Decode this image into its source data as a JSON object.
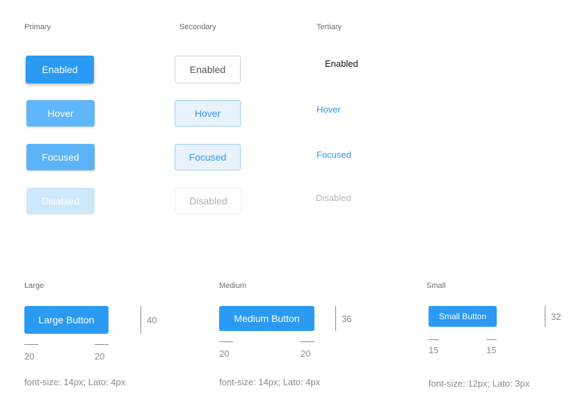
{
  "columns": {
    "primary": "Primary",
    "secondary": "Secondary",
    "tertiary": "Tertiary"
  },
  "states": {
    "primary": {
      "enabled": "Enabled",
      "hover": "Hover",
      "focused": "Focused",
      "disabled": "Disabled"
    },
    "secondary": {
      "enabled": "Enabled",
      "hover": "Hover",
      "focused": "Focused",
      "disabled": "Disabled"
    },
    "tertiary": {
      "enabled": "Enabled",
      "hover": "Hover",
      "focused": "Focused",
      "disabled": "Disabled"
    }
  },
  "sizes": {
    "large": {
      "heading": "Large",
      "button": "Large Button",
      "height": "40",
      "pad_left": "20",
      "pad_right": "20",
      "spec": "font-size: 14px; Lato: 4px"
    },
    "medium": {
      "heading": "Medium",
      "button": "Medium Button",
      "height": "36",
      "pad_left": "20",
      "pad_right": "20",
      "spec": "font-size: 14px; Lato: 4px"
    },
    "small": {
      "heading": "Small",
      "button": "Small Button",
      "height": "32",
      "pad_left": "15",
      "pad_right": "15",
      "spec": "font-size: 12px; Lato: 3px"
    }
  },
  "colors": {
    "primary": "#2b9af3",
    "primary_hover": "#60b6fb",
    "primary_disabled": "#cfe7fb",
    "secondary_hover_bg": "#e8f2fc",
    "text_muted": "#8a8a8a"
  }
}
